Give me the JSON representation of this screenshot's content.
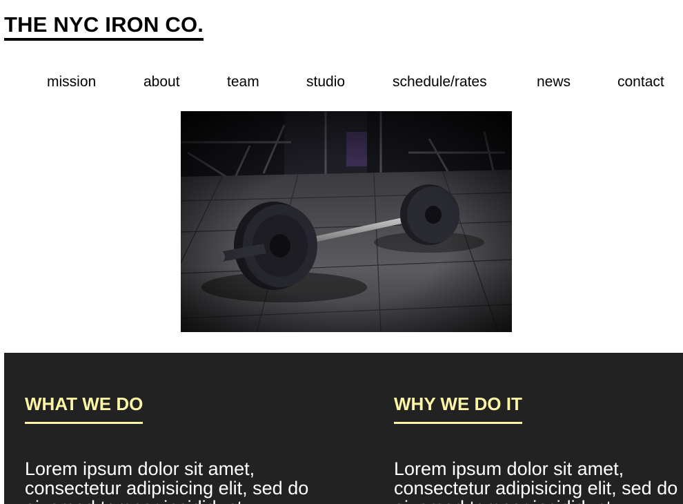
{
  "header": {
    "brand": "THE NYC IRON CO."
  },
  "nav": {
    "items": [
      {
        "label": "mission"
      },
      {
        "label": "about"
      },
      {
        "label": "team"
      },
      {
        "label": "studio"
      },
      {
        "label": "schedule/rates"
      },
      {
        "label": "news"
      },
      {
        "label": "contact"
      }
    ]
  },
  "hero": {
    "image": "barbell-on-gym-floor-photo"
  },
  "sections": [
    {
      "heading": "WHAT WE DO",
      "body": "Lorem ipsum dolor sit amet, consectetur adipisicing elit, sed do eiusmod tempor incididunt"
    },
    {
      "heading": "WHY WE DO IT",
      "body": "Lorem ipsum dolor sit amet, consectetur adipisicing elit, sed do eiusmod tempor incididunt"
    }
  ],
  "colors": {
    "accent": "#fdf5a6",
    "dark_background": "#222222",
    "text": "#000000"
  }
}
